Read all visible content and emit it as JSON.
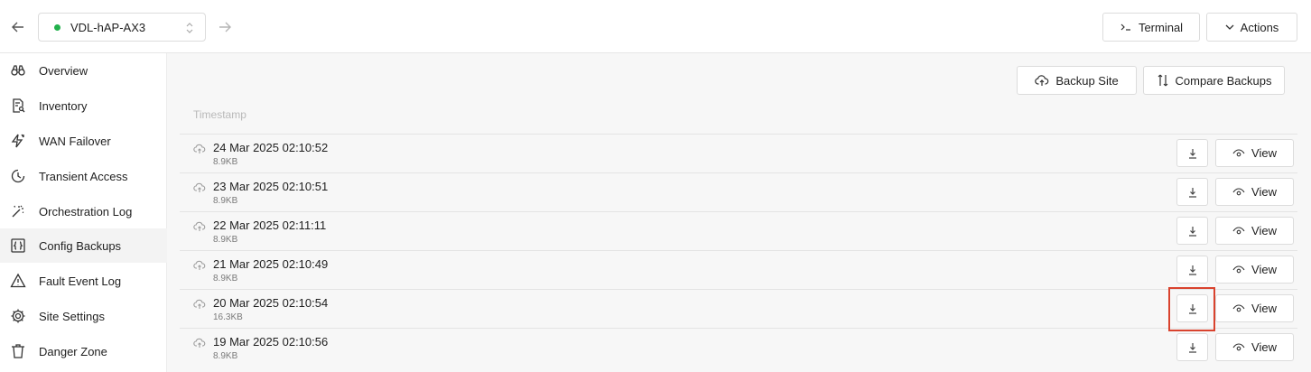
{
  "header": {
    "site_name": "VDL-hAP-AX3",
    "status_color": "#22b14c",
    "terminal_label": "Terminal",
    "actions_label": "Actions"
  },
  "sidebar": {
    "items": [
      {
        "label": "Overview",
        "icon": "binoculars-icon"
      },
      {
        "label": "Inventory",
        "icon": "document-search-icon"
      },
      {
        "label": "WAN Failover",
        "icon": "lightning-icon"
      },
      {
        "label": "Transient Access",
        "icon": "clock-icon"
      },
      {
        "label": "Orchestration Log",
        "icon": "magic-wand-icon"
      },
      {
        "label": "Config Backups",
        "icon": "code-braces-icon",
        "active": true
      },
      {
        "label": "Fault Event Log",
        "icon": "warning-icon"
      },
      {
        "label": "Site Settings",
        "icon": "gear-icon"
      },
      {
        "label": "Danger Zone",
        "icon": "trash-icon"
      }
    ]
  },
  "main": {
    "backup_site_label": "Backup Site",
    "compare_backups_label": "Compare Backups",
    "column_header": "Timestamp",
    "view_label": "View",
    "backups": [
      {
        "timestamp": "24 Mar 2025 02:10:52",
        "size": "8.9KB"
      },
      {
        "timestamp": "23 Mar 2025 02:10:51",
        "size": "8.9KB"
      },
      {
        "timestamp": "22 Mar 2025 02:11:11",
        "size": "8.9KB"
      },
      {
        "timestamp": "21 Mar 2025 02:10:49",
        "size": "8.9KB"
      },
      {
        "timestamp": "20 Mar 2025 02:10:54",
        "size": "16.3KB"
      },
      {
        "timestamp": "19 Mar 2025 02:10:56",
        "size": "8.9KB"
      }
    ]
  },
  "highlight_color": "#d9432e"
}
